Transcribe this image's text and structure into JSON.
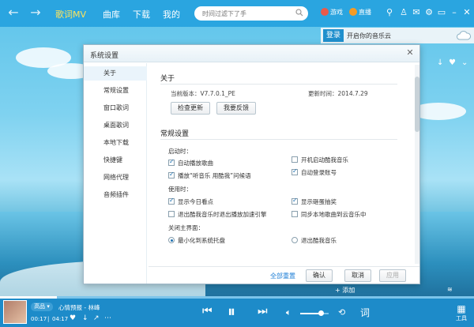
{
  "topbar": {
    "tabs": [
      {
        "label": "歌词MV",
        "active": true
      },
      {
        "label": "曲库",
        "active": false
      },
      {
        "label": "下载",
        "active": false
      },
      {
        "label": "我的",
        "active": false
      }
    ],
    "search_placeholder": "时间过滤下了手",
    "game_label": "游戏",
    "live_label": "直播",
    "accent": "#2aa5e0"
  },
  "right_panel": {
    "login_label": "登录",
    "login_prompt": "开启你的音乐云"
  },
  "dialog": {
    "title": "系统设置",
    "sidebar": [
      "关于",
      "常规设置",
      "窗口歌词",
      "桌面歌词",
      "本地下载",
      "快捷键",
      "网络代理",
      "音频插件"
    ],
    "about": {
      "heading": "关于",
      "version": "当前版本：V7.7.0.1_PE",
      "updated": "更新时间：2014.7.29",
      "check_update": "检查更新",
      "feedback": "我要反馈"
    },
    "general": {
      "heading": "常规设置",
      "on_start_label": "启动时：",
      "on_start": [
        {
          "label": "自动播放歌曲",
          "checked": true
        },
        {
          "label": "开机启动酷我音乐",
          "checked": false
        },
        {
          "label": "播放“听音乐 用酷我”问候语",
          "checked": true
        },
        {
          "label": "自动登录账号",
          "checked": true
        }
      ],
      "in_use_label": "使用时：",
      "in_use": [
        {
          "label": "显示今日看点",
          "checked": true
        },
        {
          "label": "显示砸蛋抽奖",
          "checked": true
        },
        {
          "label": "退出酷我音乐时退出播放加速引擎",
          "checked": false
        },
        {
          "label": "同步本地歌曲到云音乐中",
          "checked": false
        }
      ],
      "close_label": "关闭主界面：",
      "close_options": [
        {
          "label": "最小化到系统托盘",
          "selected": true
        },
        {
          "label": "退出酷我音乐",
          "selected": false
        }
      ]
    },
    "footer": {
      "reset": "全部重置",
      "ok": "确认",
      "cancel": "取消",
      "apply": "应用"
    }
  },
  "player": {
    "quality": "高品",
    "song": "心情预报 - 林峰",
    "elapsed": "00:17",
    "duration": "04:17",
    "progress": 0.12,
    "volume": 0.72,
    "tools_label": "工具",
    "add_label": "添加",
    "lyric_label": "词"
  }
}
